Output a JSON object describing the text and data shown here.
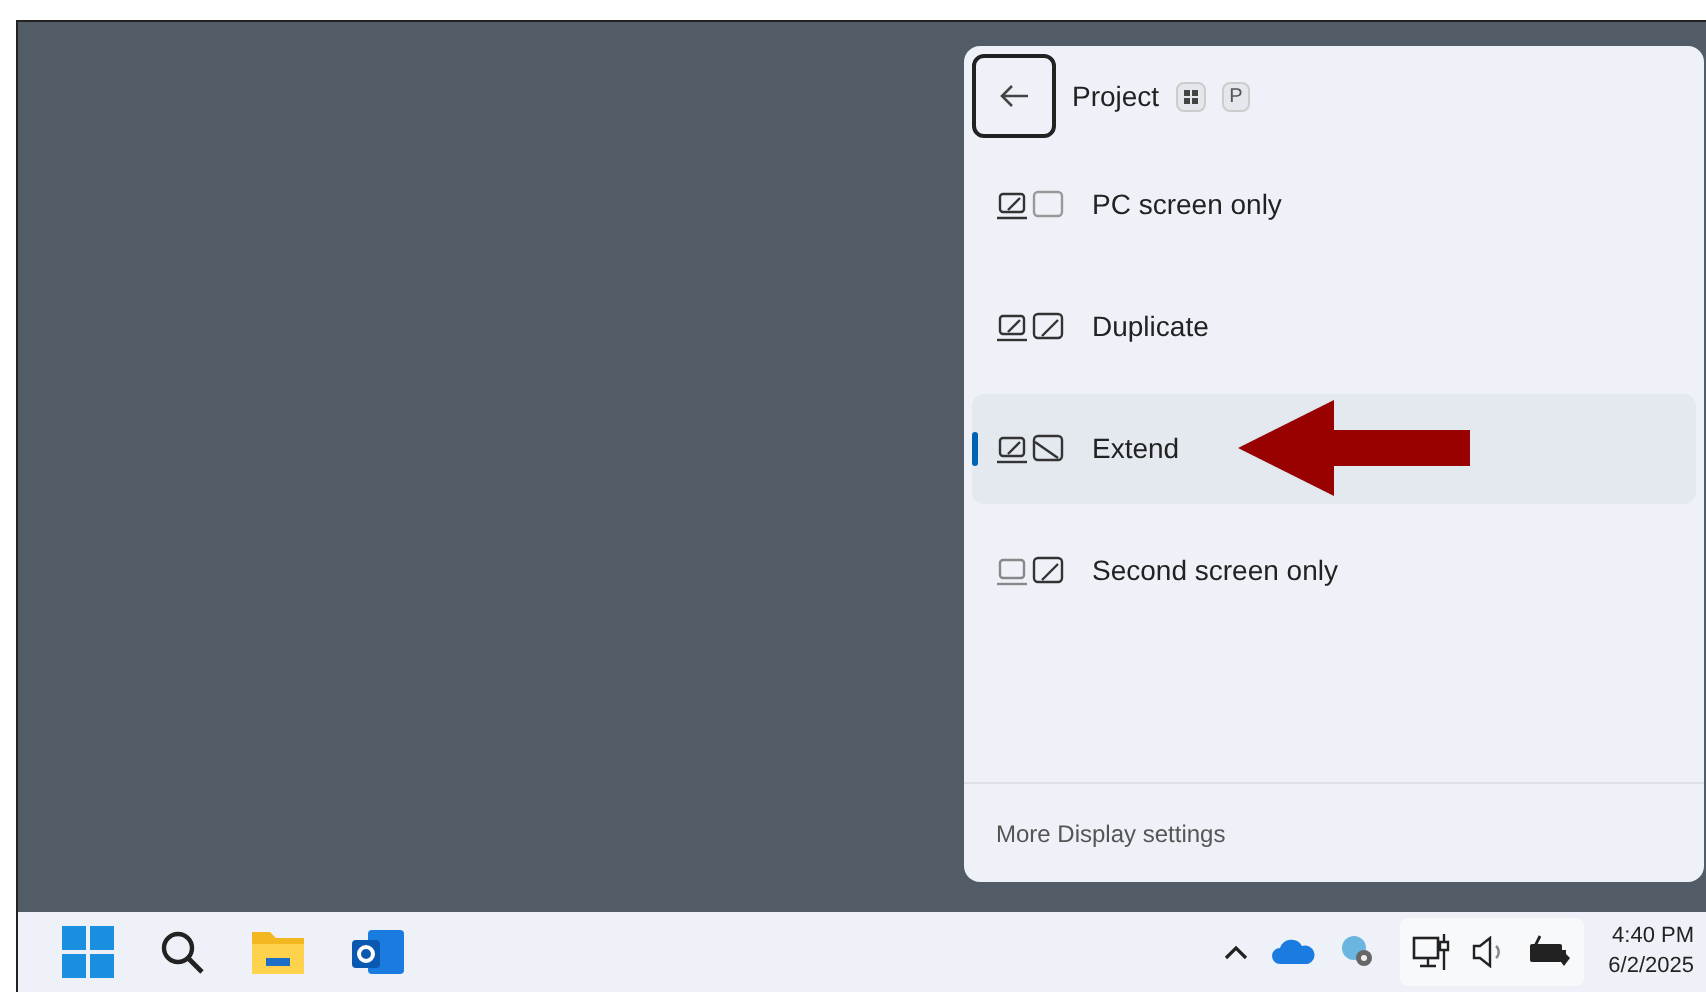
{
  "panel": {
    "title": "Project",
    "shortcut_key": "P",
    "options": [
      {
        "kind": "pc_only",
        "label": "PC screen only",
        "selected": false
      },
      {
        "kind": "duplicate",
        "label": "Duplicate",
        "selected": false
      },
      {
        "kind": "extend",
        "label": "Extend",
        "selected": true
      },
      {
        "kind": "second_only",
        "label": "Second screen only",
        "selected": false
      }
    ],
    "footer_link": "More Display settings"
  },
  "taskbar": {
    "time": "4:40 PM",
    "date": "6/2/2025"
  }
}
